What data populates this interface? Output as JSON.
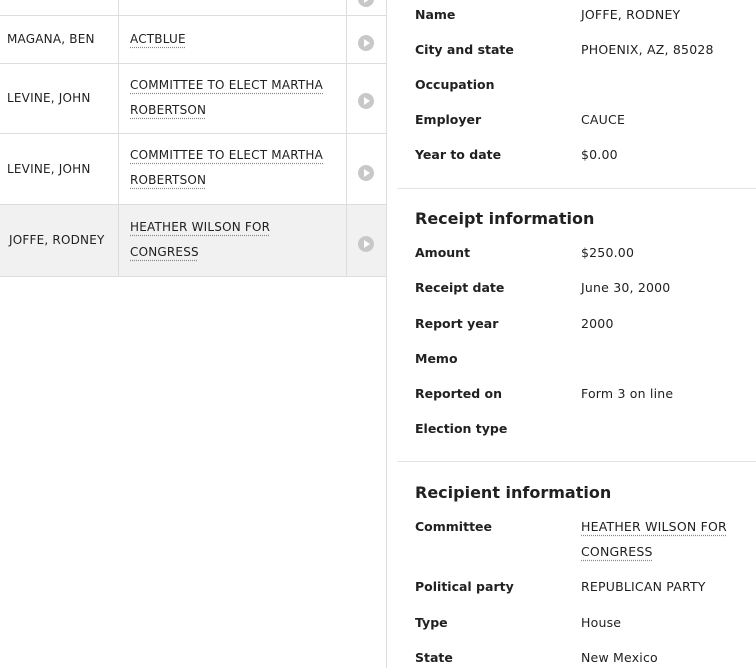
{
  "table": {
    "rows": [
      {
        "name": "MAGANA, BEN",
        "recipient": [
          "ACTBLUE"
        ]
      },
      {
        "name": "LEVINE, JOHN",
        "recipient": [
          "COMMITTEE TO ELECT MARTHA",
          "ROBERTSON"
        ]
      },
      {
        "name": "LEVINE, JOHN",
        "recipient": [
          "COMMITTEE TO ELECT MARTHA",
          "ROBERTSON"
        ]
      },
      {
        "name": "JOFFE, RODNEY",
        "recipient": [
          "HEATHER WILSON FOR",
          "CONGRESS"
        ]
      }
    ]
  },
  "contributor": {
    "name_label": "Name",
    "name": "JOFFE, RODNEY",
    "city_label": "City and state",
    "city": "PHOENIX, AZ, 85028",
    "occupation_label": "Occupation",
    "occupation": "",
    "employer_label": "Employer",
    "employer": "CAUCE",
    "ytd_label": "Year to date",
    "ytd": "$0.00"
  },
  "receipt": {
    "title": "Receipt information",
    "amount_label": "Amount",
    "amount": "$250.00",
    "date_label": "Receipt date",
    "date": "June 30, 2000",
    "year_label": "Report year",
    "year": "2000",
    "memo_label": "Memo",
    "memo": "",
    "reported_label": "Reported on",
    "reported": "Form 3 on line",
    "election_label": "Election type",
    "election": ""
  },
  "recipient": {
    "title": "Recipient information",
    "committee_label": "Committee",
    "committee": [
      "HEATHER WILSON FOR",
      "CONGRESS"
    ],
    "party_label": "Political party",
    "party": "REPUBLICAN PARTY",
    "type_label": "Type",
    "type": "House",
    "state_label": "State",
    "state": "New Mexico"
  }
}
